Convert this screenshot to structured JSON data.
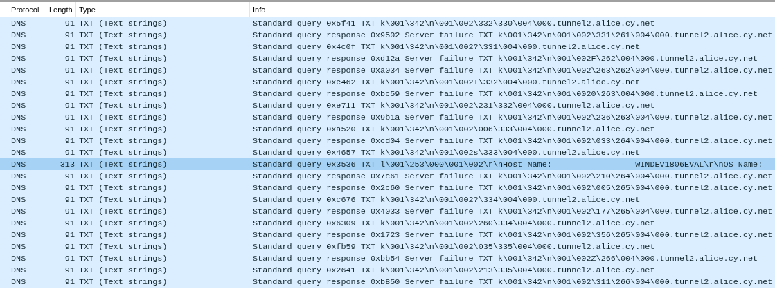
{
  "columns": [
    {
      "label": "Protocol"
    },
    {
      "label": "Length"
    },
    {
      "label": "Type"
    },
    {
      "label": "Info"
    }
  ],
  "rows": [
    {
      "protocol": "DNS",
      "length": "91",
      "type": "TXT (Text strings)",
      "info": "Standard query 0x5f41 TXT k\\001\\342\\n\\001\\002\\332\\330\\004\\000.tunnel2.alice.cy.net",
      "selected": false
    },
    {
      "protocol": "DNS",
      "length": "91",
      "type": "TXT (Text strings)",
      "info": "Standard query response 0x9502 Server failure TXT k\\001\\342\\n\\001\\002\\331\\261\\004\\000.tunnel2.alice.cy.net",
      "selected": false
    },
    {
      "protocol": "DNS",
      "length": "91",
      "type": "TXT (Text strings)",
      "info": "Standard query 0x4c0f TXT k\\001\\342\\n\\001\\002?\\331\\004\\000.tunnel2.alice.cy.net",
      "selected": false
    },
    {
      "protocol": "DNS",
      "length": "91",
      "type": "TXT (Text strings)",
      "info": "Standard query response 0xd12a Server failure TXT k\\001\\342\\n\\001\\002F\\262\\004\\000.tunnel2.alice.cy.net",
      "selected": false
    },
    {
      "protocol": "DNS",
      "length": "91",
      "type": "TXT (Text strings)",
      "info": "Standard query response 0xa034 Server failure TXT k\\001\\342\\n\\001\\002\\263\\262\\004\\000.tunnel2.alice.cy.net",
      "selected": false
    },
    {
      "protocol": "DNS",
      "length": "91",
      "type": "TXT (Text strings)",
      "info": "Standard query 0xe462 TXT k\\001\\342\\n\\001\\002+\\332\\004\\000.tunnel2.alice.cy.net",
      "selected": false
    },
    {
      "protocol": "DNS",
      "length": "91",
      "type": "TXT (Text strings)",
      "info": "Standard query response 0xbc59 Server failure TXT k\\001\\342\\n\\001\\0020\\263\\004\\000.tunnel2.alice.cy.net",
      "selected": false
    },
    {
      "protocol": "DNS",
      "length": "91",
      "type": "TXT (Text strings)",
      "info": "Standard query 0xe711 TXT k\\001\\342\\n\\001\\002\\231\\332\\004\\000.tunnel2.alice.cy.net",
      "selected": false
    },
    {
      "protocol": "DNS",
      "length": "91",
      "type": "TXT (Text strings)",
      "info": "Standard query response 0x9b1a Server failure TXT k\\001\\342\\n\\001\\002\\236\\263\\004\\000.tunnel2.alice.cy.net",
      "selected": false
    },
    {
      "protocol": "DNS",
      "length": "91",
      "type": "TXT (Text strings)",
      "info": "Standard query 0xa520 TXT k\\001\\342\\n\\001\\002\\006\\333\\004\\000.tunnel2.alice.cy.net",
      "selected": false
    },
    {
      "protocol": "DNS",
      "length": "91",
      "type": "TXT (Text strings)",
      "info": "Standard query response 0xcd04 Server failure TXT k\\001\\342\\n\\001\\002\\033\\264\\004\\000.tunnel2.alice.cy.net",
      "selected": false
    },
    {
      "protocol": "DNS",
      "length": "91",
      "type": "TXT (Text strings)",
      "info": "Standard query 0x4657 TXT k\\001\\342\\n\\001\\002s\\333\\004\\000.tunnel2.alice.cy.net",
      "selected": false
    },
    {
      "protocol": "DNS",
      "length": "313",
      "type": "TXT (Text strings)",
      "info": "Standard query 0x3536 TXT l\\001\\253\\000\\001\\002\\r\\nHost Name:                 WINDEV1806EVAL\\r\\nOS Name:",
      "selected": true
    },
    {
      "protocol": "DNS",
      "length": "91",
      "type": "TXT (Text strings)",
      "info": "Standard query response 0x7c61 Server failure TXT k\\001\\342\\n\\001\\002\\210\\264\\004\\000.tunnel2.alice.cy.net",
      "selected": false
    },
    {
      "protocol": "DNS",
      "length": "91",
      "type": "TXT (Text strings)",
      "info": "Standard query response 0x2c60 Server failure TXT k\\001\\342\\n\\001\\002\\005\\265\\004\\000.tunnel2.alice.cy.net",
      "selected": false
    },
    {
      "protocol": "DNS",
      "length": "91",
      "type": "TXT (Text strings)",
      "info": "Standard query 0xc676 TXT k\\001\\342\\n\\001\\002?\\334\\004\\000.tunnel2.alice.cy.net",
      "selected": false
    },
    {
      "protocol": "DNS",
      "length": "91",
      "type": "TXT (Text strings)",
      "info": "Standard query response 0x4033 Server failure TXT k\\001\\342\\n\\001\\002\\177\\265\\004\\000.tunnel2.alice.cy.net",
      "selected": false
    },
    {
      "protocol": "DNS",
      "length": "91",
      "type": "TXT (Text strings)",
      "info": "Standard query 0x6309 TXT k\\001\\342\\n\\001\\002\\260\\334\\004\\000.tunnel2.alice.cy.net",
      "selected": false
    },
    {
      "protocol": "DNS",
      "length": "91",
      "type": "TXT (Text strings)",
      "info": "Standard query response 0x1723 Server failure TXT k\\001\\342\\n\\001\\002\\356\\265\\004\\000.tunnel2.alice.cy.net",
      "selected": false
    },
    {
      "protocol": "DNS",
      "length": "91",
      "type": "TXT (Text strings)",
      "info": "Standard query 0xfb59 TXT k\\001\\342\\n\\001\\002\\035\\335\\004\\000.tunnel2.alice.cy.net",
      "selected": false
    },
    {
      "protocol": "DNS",
      "length": "91",
      "type": "TXT (Text strings)",
      "info": "Standard query response 0xbb54 Server failure TXT k\\001\\342\\n\\001\\002Z\\266\\004\\000.tunnel2.alice.cy.net",
      "selected": false
    },
    {
      "protocol": "DNS",
      "length": "91",
      "type": "TXT (Text strings)",
      "info": "Standard query 0x2641 TXT k\\001\\342\\n\\001\\002\\213\\335\\004\\000.tunnel2.alice.cy.net",
      "selected": false
    },
    {
      "protocol": "DNS",
      "length": "91",
      "type": "TXT (Text strings)",
      "info": "Standard query response 0xb850 Server failure TXT k\\001\\342\\n\\001\\002\\311\\266\\004\\000.tunnel2.alice.cy.net",
      "selected": false
    }
  ]
}
